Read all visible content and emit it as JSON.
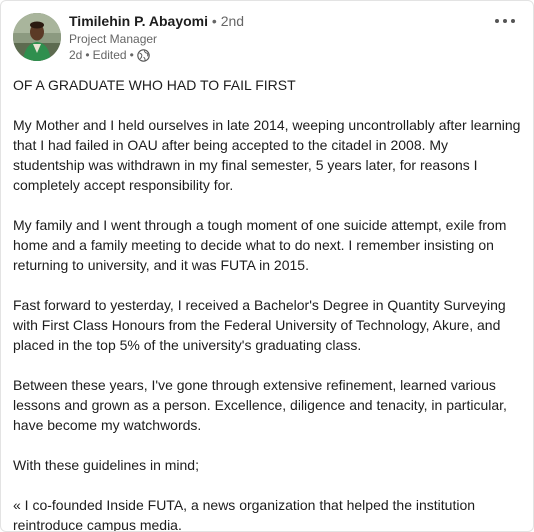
{
  "author": {
    "name": "Timilehin P. Abayomi",
    "degree": "2nd",
    "headline": "Project Manager",
    "time": "2d",
    "edited": "Edited"
  },
  "icons": {
    "more": "more-options-icon",
    "visibility": "globe-icon"
  },
  "post": {
    "title": "OF A GRADUATE WHO HAD TO FAIL FIRST",
    "paragraphs": [
      "My Mother and I held ourselves in late 2014, weeping uncontrollably after learning that I had failed in OAU after being accepted to the citadel in 2008. My studentship was withdrawn in my final semester, 5 years later, for reasons I completely accept responsibility for.",
      "My family and I went through a tough moment of one suicide attempt, exile from home and a family meeting to decide what to do next. I remember insisting on returning to university, and it was FUTA in 2015.",
      "Fast forward to yesterday, I received a Bachelor's Degree in Quantity Surveying with First Class Honours from the Federal University of Technology, Akure, and placed in the top 5% of the university's graduating class.",
      "Between these years, I've gone through extensive refinement, learned various lessons and grown as a person. Excellence, diligence and tenacity, in particular, have become my watchwords.",
      "With these guidelines in mind;",
      "« I co-founded Inside FUTA, a news organization that helped the institution reintroduce campus media."
    ]
  },
  "colors": {
    "text": "#1d1d1d",
    "secondary": "#666666",
    "border": "#e3e3e3"
  }
}
